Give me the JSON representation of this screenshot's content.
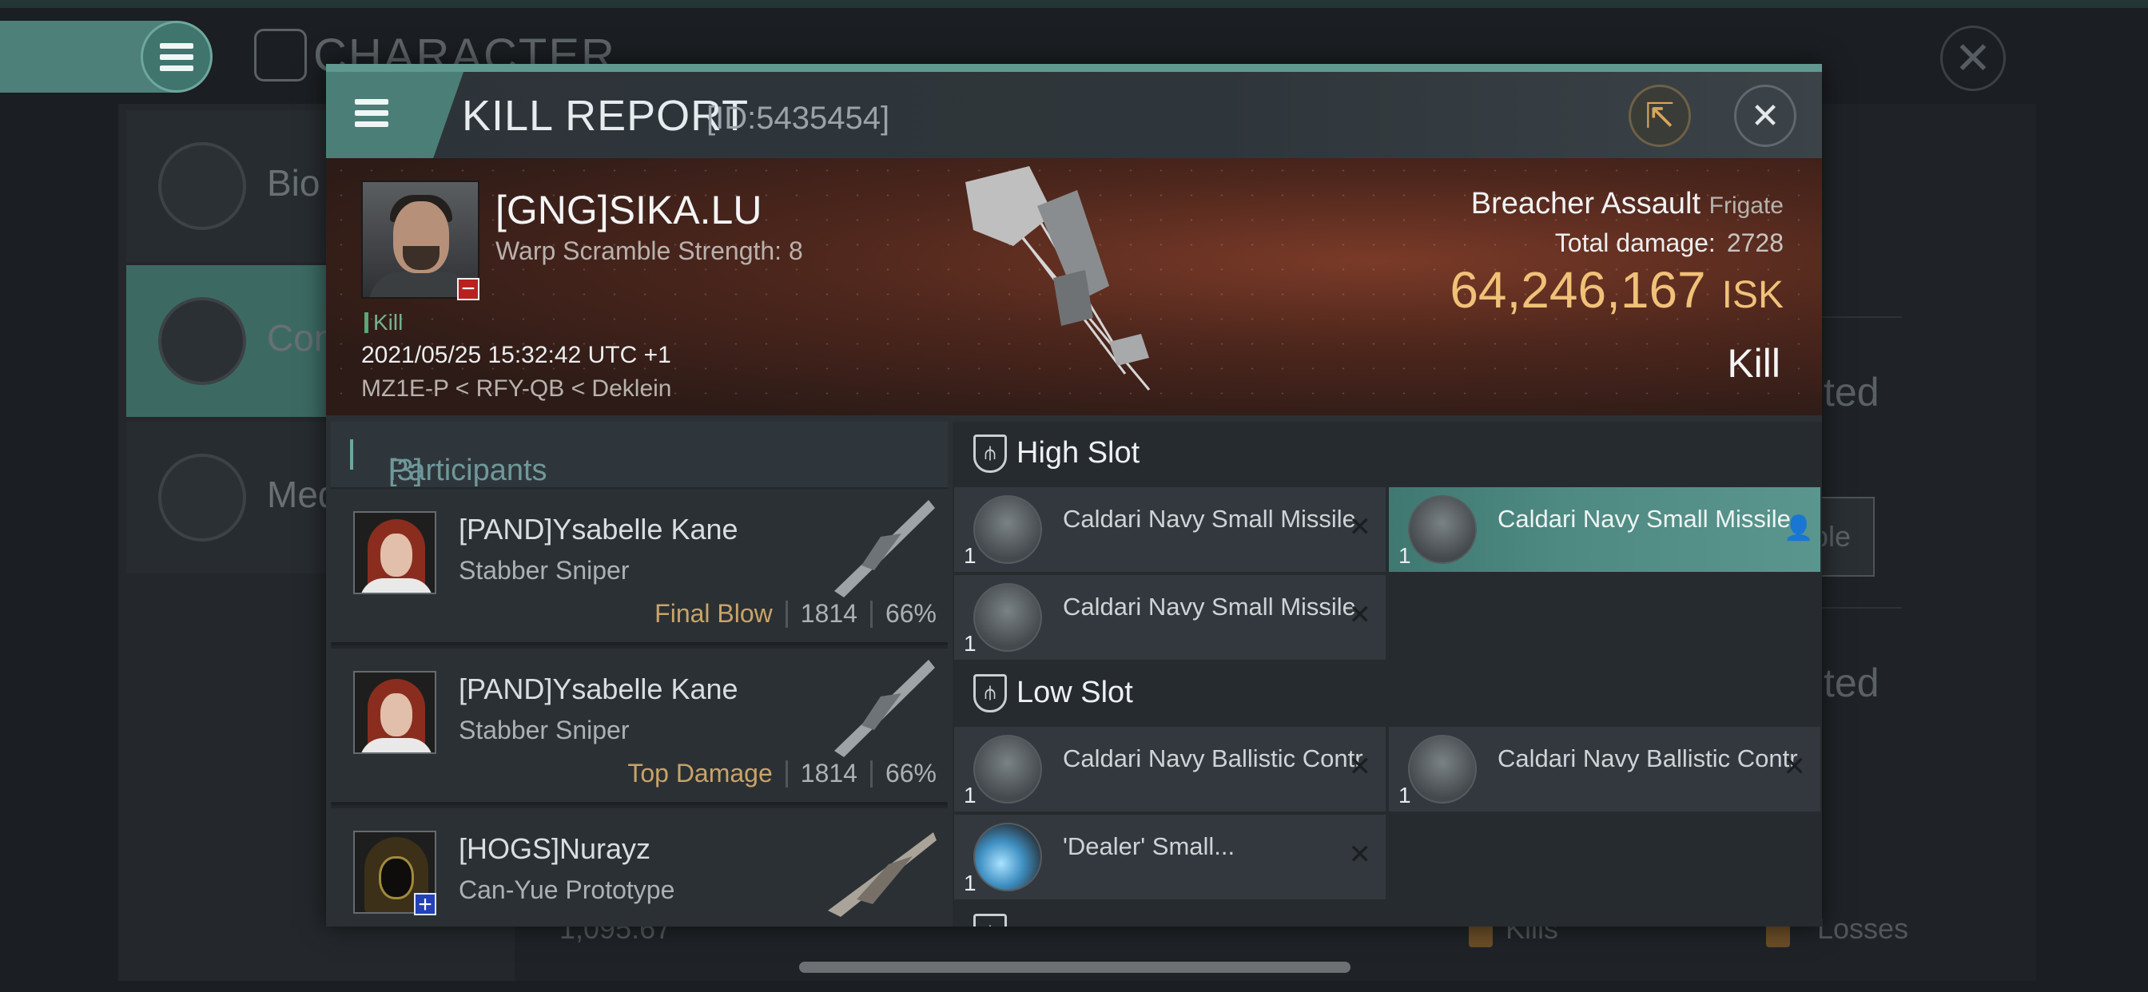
{
  "background": {
    "screen_title": "CHARACTER",
    "sidebar": [
      {
        "label": "Bio"
      },
      {
        "label": "Con"
      },
      {
        "label": "Med"
      }
    ],
    "right_texts": [
      "ted",
      "ble",
      "ted"
    ],
    "bottom": {
      "value": "1,095.67",
      "kills_label": "Kills",
      "losses_label": "Losses"
    }
  },
  "dialog": {
    "title": "KILL REPORT",
    "report_id": "[ID:5435454]",
    "victim": {
      "name": "[GNG]SIKA.LU",
      "detail": "Warp Scramble Strength: 8",
      "tag": "Kill",
      "datetime": "2021/05/25 15:32:42 UTC +1",
      "location": "MZ1E-P < RFY-QB < Deklein",
      "ship_name": "Breacher Assault",
      "ship_class": "Frigate",
      "total_damage_label": "Total damage:",
      "total_damage": "2728",
      "isk_value": "64,246,167",
      "isk_unit": "ISK",
      "result": "Kill"
    },
    "participants": {
      "label": "Participants",
      "count": "[3]",
      "items": [
        {
          "name": "[PAND]Ysabelle Kane",
          "ship": "Stabber Sniper",
          "role": "Final Blow",
          "damage": "1814",
          "percent": "66%"
        },
        {
          "name": "[PAND]Ysabelle Kane",
          "ship": "Stabber Sniper",
          "role": "Top Damage",
          "damage": "1814",
          "percent": "66%"
        },
        {
          "name": "[HOGS]Nurayz",
          "ship": "Can-Yue Prototype"
        }
      ]
    },
    "slots": {
      "high": {
        "label": "High Slot",
        "modules": [
          {
            "name": "Caldari Navy Small Missile...",
            "qty": "1"
          },
          {
            "name": "Caldari Navy Small Missile...",
            "qty": "1"
          },
          {
            "name": "Caldari Navy Small Missile...",
            "qty": "1"
          }
        ]
      },
      "low": {
        "label": "Low Slot",
        "modules": [
          {
            "name": "Caldari Navy Ballistic Contr...",
            "qty": "1"
          },
          {
            "name": "Caldari Navy Ballistic Contr...",
            "qty": "1"
          },
          {
            "name": "'Dealer' Small...",
            "qty": "1"
          }
        ]
      }
    }
  },
  "colors": {
    "accent": "#4b7e77",
    "isk": "#f0c178",
    "final_blow": "#c9a468"
  }
}
